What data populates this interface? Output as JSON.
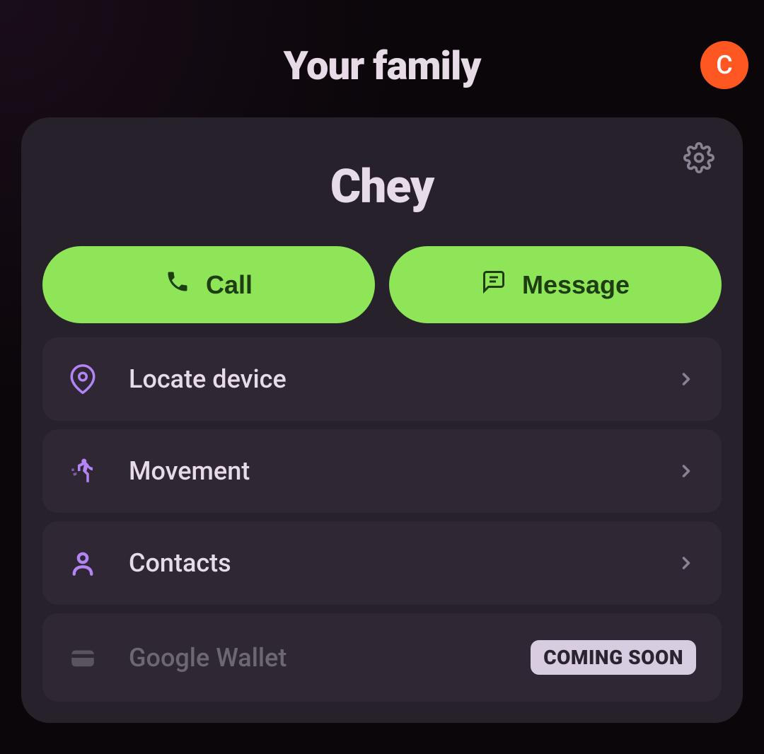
{
  "header": {
    "title": "Your family",
    "avatar_initial": "C"
  },
  "member": {
    "name": "Chey",
    "actions": {
      "call_label": "Call",
      "message_label": "Message"
    },
    "menu": [
      {
        "icon": "location-pin",
        "label": "Locate device",
        "enabled": true
      },
      {
        "icon": "movement",
        "label": "Movement",
        "enabled": true
      },
      {
        "icon": "person",
        "label": "Contacts",
        "enabled": true
      },
      {
        "icon": "wallet",
        "label": "Google Wallet",
        "enabled": false,
        "badge": "COMING SOON"
      }
    ]
  },
  "colors": {
    "accent_green": "#8ee558",
    "accent_purple": "#b384f4",
    "avatar_bg": "#ff5722",
    "card_bg": "#27212b",
    "item_bg": "#2f2834"
  }
}
